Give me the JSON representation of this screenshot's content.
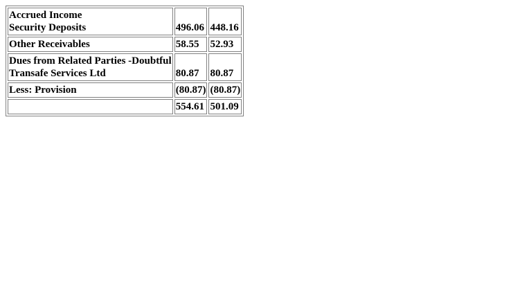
{
  "rows": [
    {
      "label_lines": [
        "Accrued Income",
        "Security Deposits"
      ],
      "values": [
        "496.06",
        "448.16"
      ]
    },
    {
      "label_lines": [
        "Other Receivables"
      ],
      "values": [
        "58.55",
        "52.93"
      ]
    },
    {
      "label_lines": [
        "Dues from Related Parties -Doubtful",
        "Transafe Services Ltd"
      ],
      "values": [
        "80.87",
        "80.87"
      ]
    },
    {
      "label_lines": [
        "Less: Provision"
      ],
      "values": [
        "(80.87)",
        "(80.87)"
      ]
    },
    {
      "label_lines": [
        ""
      ],
      "values": [
        "554.61",
        "501.09"
      ]
    }
  ]
}
